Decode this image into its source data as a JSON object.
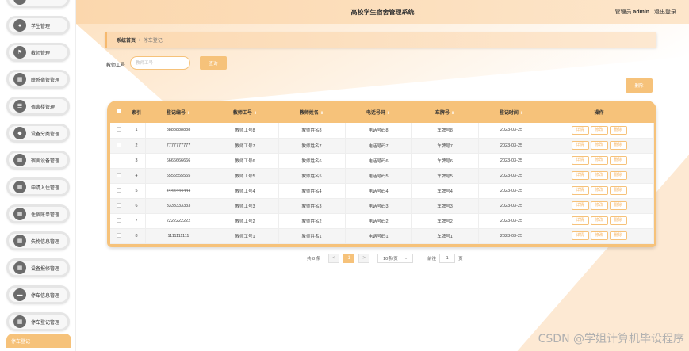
{
  "header": {
    "title": "高校学生宿舍管理系统",
    "role_label": "管理员",
    "username": "admin",
    "logout": "退出登录"
  },
  "sidebar": {
    "items": [
      {
        "label": "",
        "icon": "person-icon"
      },
      {
        "label": "学生管理",
        "icon": "person-icon"
      },
      {
        "label": "教师管理",
        "icon": "flag-icon"
      },
      {
        "label": "联系宿管管理",
        "icon": "grid-icon"
      },
      {
        "label": "宿舍楼管理",
        "icon": "list-icon"
      },
      {
        "label": "设备分类管理",
        "icon": "pin-icon"
      },
      {
        "label": "宿舍设备管理",
        "icon": "grid-icon"
      },
      {
        "label": "申请入住管理",
        "icon": "grid-icon"
      },
      {
        "label": "住宿账单管理",
        "icon": "grid-icon"
      },
      {
        "label": "失物信息管理",
        "icon": "grid-icon"
      },
      {
        "label": "设备报修管理",
        "icon": "grid-icon"
      },
      {
        "label": "停车信息管理",
        "icon": "car-icon"
      },
      {
        "label": "停车登记管理",
        "icon": "grid-icon"
      }
    ],
    "active": "停车登记"
  },
  "breadcrumb": {
    "home": "系统首页",
    "sep": "/",
    "current": "停车登记"
  },
  "search": {
    "label": "教师工号",
    "placeholder": "教师工号",
    "button": "查询"
  },
  "actions": {
    "delete": "删除"
  },
  "table": {
    "columns": [
      "索引",
      "登记编号",
      "教师工号",
      "教师姓名",
      "电话号码",
      "车牌号",
      "登记时间",
      "操作"
    ],
    "row_buttons": {
      "detail": "详情",
      "edit": "修改",
      "delete": "删除"
    },
    "rows": [
      {
        "index": "1",
        "reg_no": "8888888888",
        "teacher_id": "教师工号8",
        "teacher_name": "教师姓名8",
        "phone": "电话号码8",
        "plate": "车牌号8",
        "date": "2023-03-25"
      },
      {
        "index": "2",
        "reg_no": "7777777777",
        "teacher_id": "教师工号7",
        "teacher_name": "教师姓名7",
        "phone": "电话号码7",
        "plate": "车牌号7",
        "date": "2023-03-25"
      },
      {
        "index": "3",
        "reg_no": "6666666666",
        "teacher_id": "教师工号6",
        "teacher_name": "教师姓名6",
        "phone": "电话号码6",
        "plate": "车牌号6",
        "date": "2023-03-25"
      },
      {
        "index": "4",
        "reg_no": "5555555555",
        "teacher_id": "教师工号5",
        "teacher_name": "教师姓名5",
        "phone": "电话号码5",
        "plate": "车牌号5",
        "date": "2023-03-25"
      },
      {
        "index": "5",
        "reg_no": "4444444444",
        "teacher_id": "教师工号4",
        "teacher_name": "教师姓名4",
        "phone": "电话号码4",
        "plate": "车牌号4",
        "date": "2023-03-25"
      },
      {
        "index": "6",
        "reg_no": "3333333333",
        "teacher_id": "教师工号3",
        "teacher_name": "教师姓名3",
        "phone": "电话号码3",
        "plate": "车牌号3",
        "date": "2023-03-25"
      },
      {
        "index": "7",
        "reg_no": "2222222222",
        "teacher_id": "教师工号2",
        "teacher_name": "教师姓名2",
        "phone": "电话号码2",
        "plate": "车牌号2",
        "date": "2023-03-25"
      },
      {
        "index": "8",
        "reg_no": "1111111111",
        "teacher_id": "教师工号1",
        "teacher_name": "教师姓名1",
        "phone": "电话号码1",
        "plate": "车牌号1",
        "date": "2023-03-25"
      }
    ]
  },
  "pagination": {
    "total": "共 8 条",
    "prev": "<",
    "current": "1",
    "next": ">",
    "page_size": "10条/页",
    "jump_prefix": "前往",
    "jump_value": "1",
    "jump_suffix": "页"
  },
  "watermark": "CSDN @学姐计算机毕设程序",
  "colors": {
    "accent": "#f6c27a",
    "header": "#fbd7ad"
  }
}
